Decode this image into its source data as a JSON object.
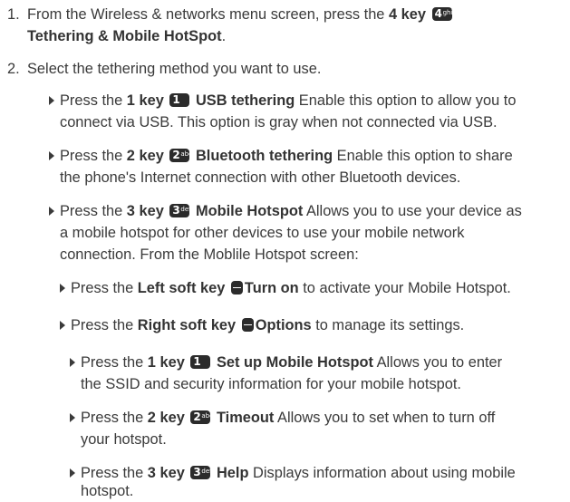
{
  "steps": [
    {
      "num": "1.",
      "line1": {
        "t1": "From the Wireless & networks menu screen, press the ",
        "b1": "4 key",
        "key": {
          "digit": "4",
          "letters": "ghi"
        }
      },
      "line2": {
        "b1": "Tethering & Mobile HotSpot",
        "t1": "."
      }
    },
    {
      "num": "2.",
      "text": "Select the tethering method you want to use."
    }
  ],
  "methods": [
    {
      "lines": [
        {
          "t1": "Press the ",
          "b1": "1 key",
          "key": {
            "digit": "1",
            "letters": ""
          },
          "b2": "USB tethering",
          "t2": " Enable this option to allow you to"
        },
        {
          "t1": "connect via USB. This option is gray when not connected via USB."
        }
      ]
    },
    {
      "lines": [
        {
          "t1": "Press the ",
          "b1": "2 key",
          "key": {
            "digit": "2",
            "letters": "abc"
          },
          "b2": "Bluetooth tethering",
          "t2": " Enable this option to share"
        },
        {
          "t1": "the phone's Internet connection with other Bluetooth devices."
        }
      ]
    },
    {
      "lines": [
        {
          "t1": "Press the ",
          "b1": "3 key",
          "key": {
            "digit": "3",
            "letters": "def"
          },
          "b2": "Mobile Hotspot",
          "t2": " Allows you to use your device as"
        },
        {
          "t1": "a mobile hotspot for other devices to use your mobile network"
        },
        {
          "t1": "connection. From the Moblile Hotspot screen:"
        }
      ]
    }
  ],
  "softkeys": [
    {
      "t1": "Press the ",
      "b1": "Left soft key",
      "b2": "Turn on",
      "t2": " to activate your Mobile Hotspot."
    },
    {
      "t1": "Press the ",
      "b1": "Right soft key",
      "b2": "Options",
      "t2": " to manage its settings."
    }
  ],
  "options": [
    {
      "lines": [
        {
          "t1": "Press the ",
          "b1": "1 key",
          "key": {
            "digit": "1",
            "letters": ""
          },
          "b2": "Set up Mobile Hotspot",
          "t2": " Allows you to enter"
        },
        {
          "t1": "the SSID and security information for your mobile hotspot."
        }
      ]
    },
    {
      "lines": [
        {
          "t1": "Press the ",
          "b1": "2 key",
          "key": {
            "digit": "2",
            "letters": "abc"
          },
          "b2": "Timeout",
          "t2": " Allows you to set when to turn off"
        },
        {
          "t1": "your hotspot."
        }
      ]
    },
    {
      "lines": [
        {
          "t1": "Press the ",
          "b1": "3 key",
          "key": {
            "digit": "3",
            "letters": "def"
          },
          "b2": "Help",
          "t2": " Displays information about using mobile"
        },
        {
          "t1": "hotspot."
        }
      ]
    }
  ]
}
